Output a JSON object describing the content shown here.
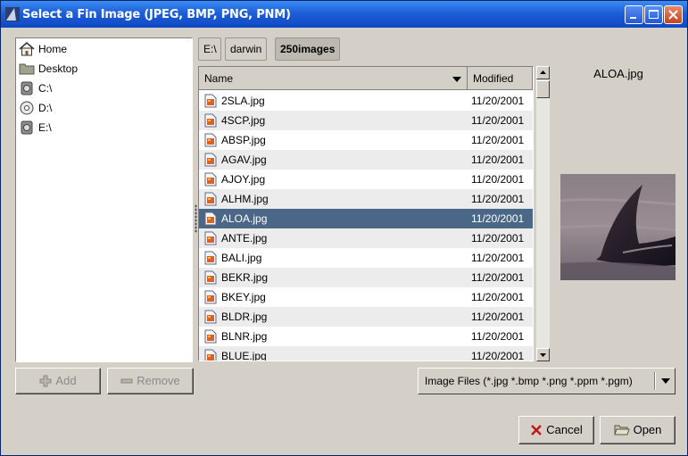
{
  "window": {
    "title": "Select a Fin Image (JPEG, BMP, PNG, PNM)"
  },
  "places": [
    {
      "label": "Home",
      "icon": "home-icon"
    },
    {
      "label": "Desktop",
      "icon": "folder-icon"
    },
    {
      "label": "C:\\",
      "icon": "drive-icon"
    },
    {
      "label": "D:\\",
      "icon": "cd-icon"
    },
    {
      "label": "E:\\",
      "icon": "drive-icon"
    }
  ],
  "path": [
    "E:\\",
    "darwin",
    "250images"
  ],
  "columns": {
    "name": "Name",
    "modified": "Modified"
  },
  "files": [
    {
      "name": "2SLA.jpg",
      "modified": "11/20/2001"
    },
    {
      "name": "4SCP.jpg",
      "modified": "11/20/2001"
    },
    {
      "name": "ABSP.jpg",
      "modified": "11/20/2001"
    },
    {
      "name": "AGAV.jpg",
      "modified": "11/20/2001"
    },
    {
      "name": "AJOY.jpg",
      "modified": "11/20/2001"
    },
    {
      "name": "ALHM.jpg",
      "modified": "11/20/2001"
    },
    {
      "name": "ALOA.jpg",
      "modified": "11/20/2001"
    },
    {
      "name": "ANTE.jpg",
      "modified": "11/20/2001"
    },
    {
      "name": "BALI.jpg",
      "modified": "11/20/2001"
    },
    {
      "name": "BEKR.jpg",
      "modified": "11/20/2001"
    },
    {
      "name": "BKEY.jpg",
      "modified": "11/20/2001"
    },
    {
      "name": "BLDR.jpg",
      "modified": "11/20/2001"
    },
    {
      "name": "BLNR.jpg",
      "modified": "11/20/2001"
    },
    {
      "name": "BLUE.jpg",
      "modified": "11/20/2001"
    }
  ],
  "selected_file": "ALOA.jpg",
  "preview": {
    "filename": "ALOA.jpg"
  },
  "buttons": {
    "add": "Add",
    "remove": "Remove",
    "cancel": "Cancel",
    "open": "Open"
  },
  "filter": {
    "selected": "Image Files (*.jpg *.bmp *.png *.ppm *.pgm)"
  },
  "colors": {
    "titlebar": "#0e48c3",
    "selection": "#4a6788",
    "dialog": "#d4d0c8"
  }
}
